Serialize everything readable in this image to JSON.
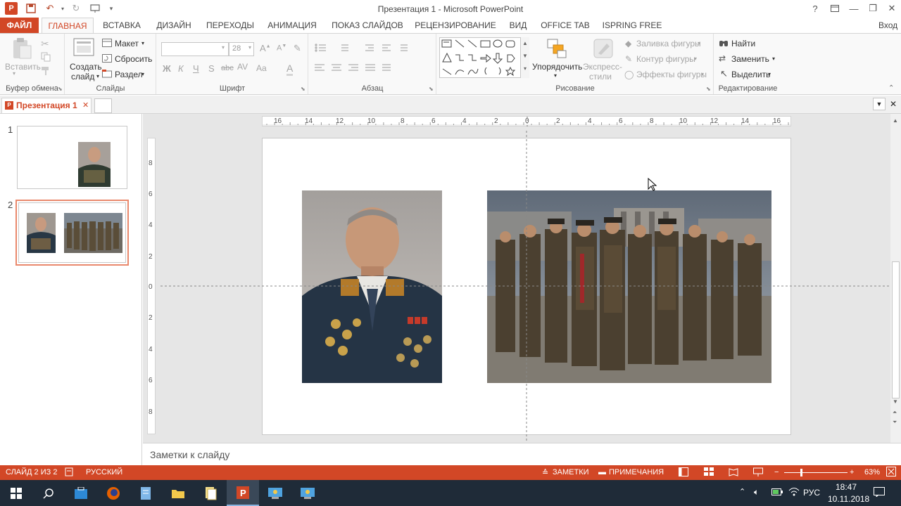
{
  "window": {
    "title": "Презентация 1 - Microsoft PowerPoint",
    "help": "?",
    "min": "—",
    "restore": "❐",
    "close": "✕",
    "signin": "Вход"
  },
  "tabs": [
    {
      "label": "ФАЙЛ"
    },
    {
      "label": "ГЛАВНАЯ"
    },
    {
      "label": "ВСТАВКА"
    },
    {
      "label": "ДИЗАЙН"
    },
    {
      "label": "ПЕРЕХОДЫ"
    },
    {
      "label": "АНИМАЦИЯ"
    },
    {
      "label": "ПОКАЗ СЛАЙДОВ"
    },
    {
      "label": "РЕЦЕНЗИРОВАНИЕ"
    },
    {
      "label": "ВИД"
    },
    {
      "label": "OFFICE TAB"
    },
    {
      "label": "ISPRING FREE 8"
    }
  ],
  "ribbon": {
    "clipboard": {
      "paste": "Вставить",
      "label": "Буфер обмена"
    },
    "slides": {
      "create1": "Создать",
      "create2": "слайд",
      "layout": "Макет",
      "reset": "Сбросить",
      "section": "Раздел",
      "label": "Слайды"
    },
    "font": {
      "size": "28",
      "bold": "Ж",
      "italic": "К",
      "underline": "Ч",
      "strike": "S",
      "spacing": "abc",
      "case": "Aa",
      "color": "A",
      "label": "Шрифт"
    },
    "paragraph": {
      "label": "Абзац"
    },
    "drawing": {
      "arrange": "Упорядочить",
      "styles1": "Экспресс-",
      "styles2": "стили",
      "fill": "Заливка фигуры",
      "outline": "Контур фигуры",
      "effects": "Эффекты фигуры",
      "label": "Рисование"
    },
    "editing": {
      "find": "Найти",
      "replace": "Заменить",
      "select": "Выделить",
      "label": "Редактирование"
    }
  },
  "doc": {
    "tab": "Презентация 1"
  },
  "thumbs": [
    {
      "num": "1"
    },
    {
      "num": "2"
    }
  ],
  "ruler": {
    "h": [
      "16",
      "14",
      "12",
      "10",
      "8",
      "6",
      "4",
      "2",
      "0",
      "2",
      "4",
      "6",
      "8",
      "10",
      "12",
      "14",
      "16"
    ],
    "v": [
      "8",
      "6",
      "4",
      "2",
      "0",
      "2",
      "4",
      "6",
      "8"
    ]
  },
  "notes": {
    "placeholder": "Заметки к слайду"
  },
  "status": {
    "slide": "СЛАЙД 2 ИЗ 2",
    "lang": "РУССКИЙ",
    "notes": "ЗАМЕТКИ",
    "comments": "ПРИМЕЧАНИЯ",
    "zoom": "63%"
  },
  "taskbar": {
    "lang": "РУС",
    "time": "18:47",
    "date": "10.11.2018"
  },
  "colors": {
    "accent": "#d24726",
    "taskbar": "#1f2b38",
    "selection": "#e9886c"
  }
}
